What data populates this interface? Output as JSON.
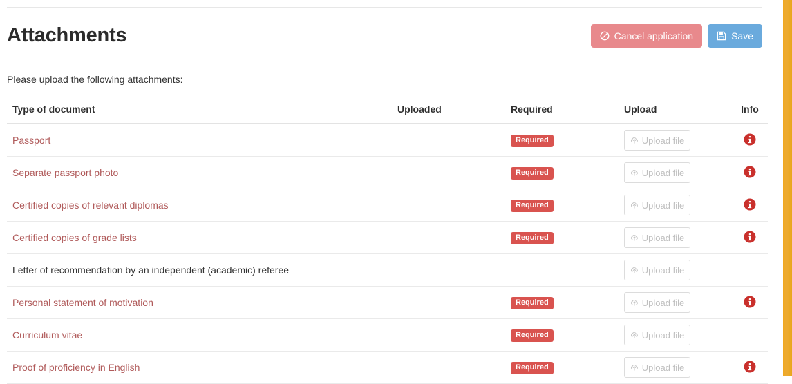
{
  "header": {
    "title": "Attachments",
    "cancel_button": {
      "label": "Cancel application",
      "icon": "ban-icon",
      "color": "#e8898c"
    },
    "save_button": {
      "label": "Save",
      "icon": "floppy-disk-icon",
      "color": "#6aaadd"
    }
  },
  "intro_text": "Please upload the following attachments:",
  "table": {
    "columns": [
      "Type of document",
      "Uploaded",
      "Required",
      "Upload",
      "Info"
    ],
    "required_badge_label": "Required",
    "upload_button_label": "Upload file",
    "upload_button_icon": "cloud-upload-icon",
    "info_icon": "info-circle-icon",
    "badge_color": "#d9534f",
    "link_color": "#b05a5a",
    "rows": [
      {
        "document": "Passport",
        "is_link": true,
        "uploaded": "",
        "required": "Required",
        "upload": "Upload file",
        "info": true
      },
      {
        "document": "Separate passport photo",
        "is_link": true,
        "uploaded": "",
        "required": "Required",
        "upload": "Upload file",
        "info": true
      },
      {
        "document": "Certified copies of relevant diplomas",
        "is_link": true,
        "uploaded": "",
        "required": "Required",
        "upload": "Upload file",
        "info": true
      },
      {
        "document": "Certified copies of grade lists",
        "is_link": true,
        "uploaded": "",
        "required": "Required",
        "upload": "Upload file",
        "info": true
      },
      {
        "document": "Letter of recommendation by an independent (academic) referee",
        "is_link": false,
        "uploaded": "",
        "required": "",
        "upload": "Upload file",
        "info": false
      },
      {
        "document": "Personal statement of motivation",
        "is_link": true,
        "uploaded": "",
        "required": "Required",
        "upload": "Upload file",
        "info": true
      },
      {
        "document": "Curriculum vitae",
        "is_link": true,
        "uploaded": "",
        "required": "Required",
        "upload": "Upload file",
        "info": false
      },
      {
        "document": "Proof of proficiency in English",
        "is_link": true,
        "uploaded": "",
        "required": "Required",
        "upload": "Upload file",
        "info": true
      }
    ]
  },
  "edge_strip_color": "#eda81e"
}
